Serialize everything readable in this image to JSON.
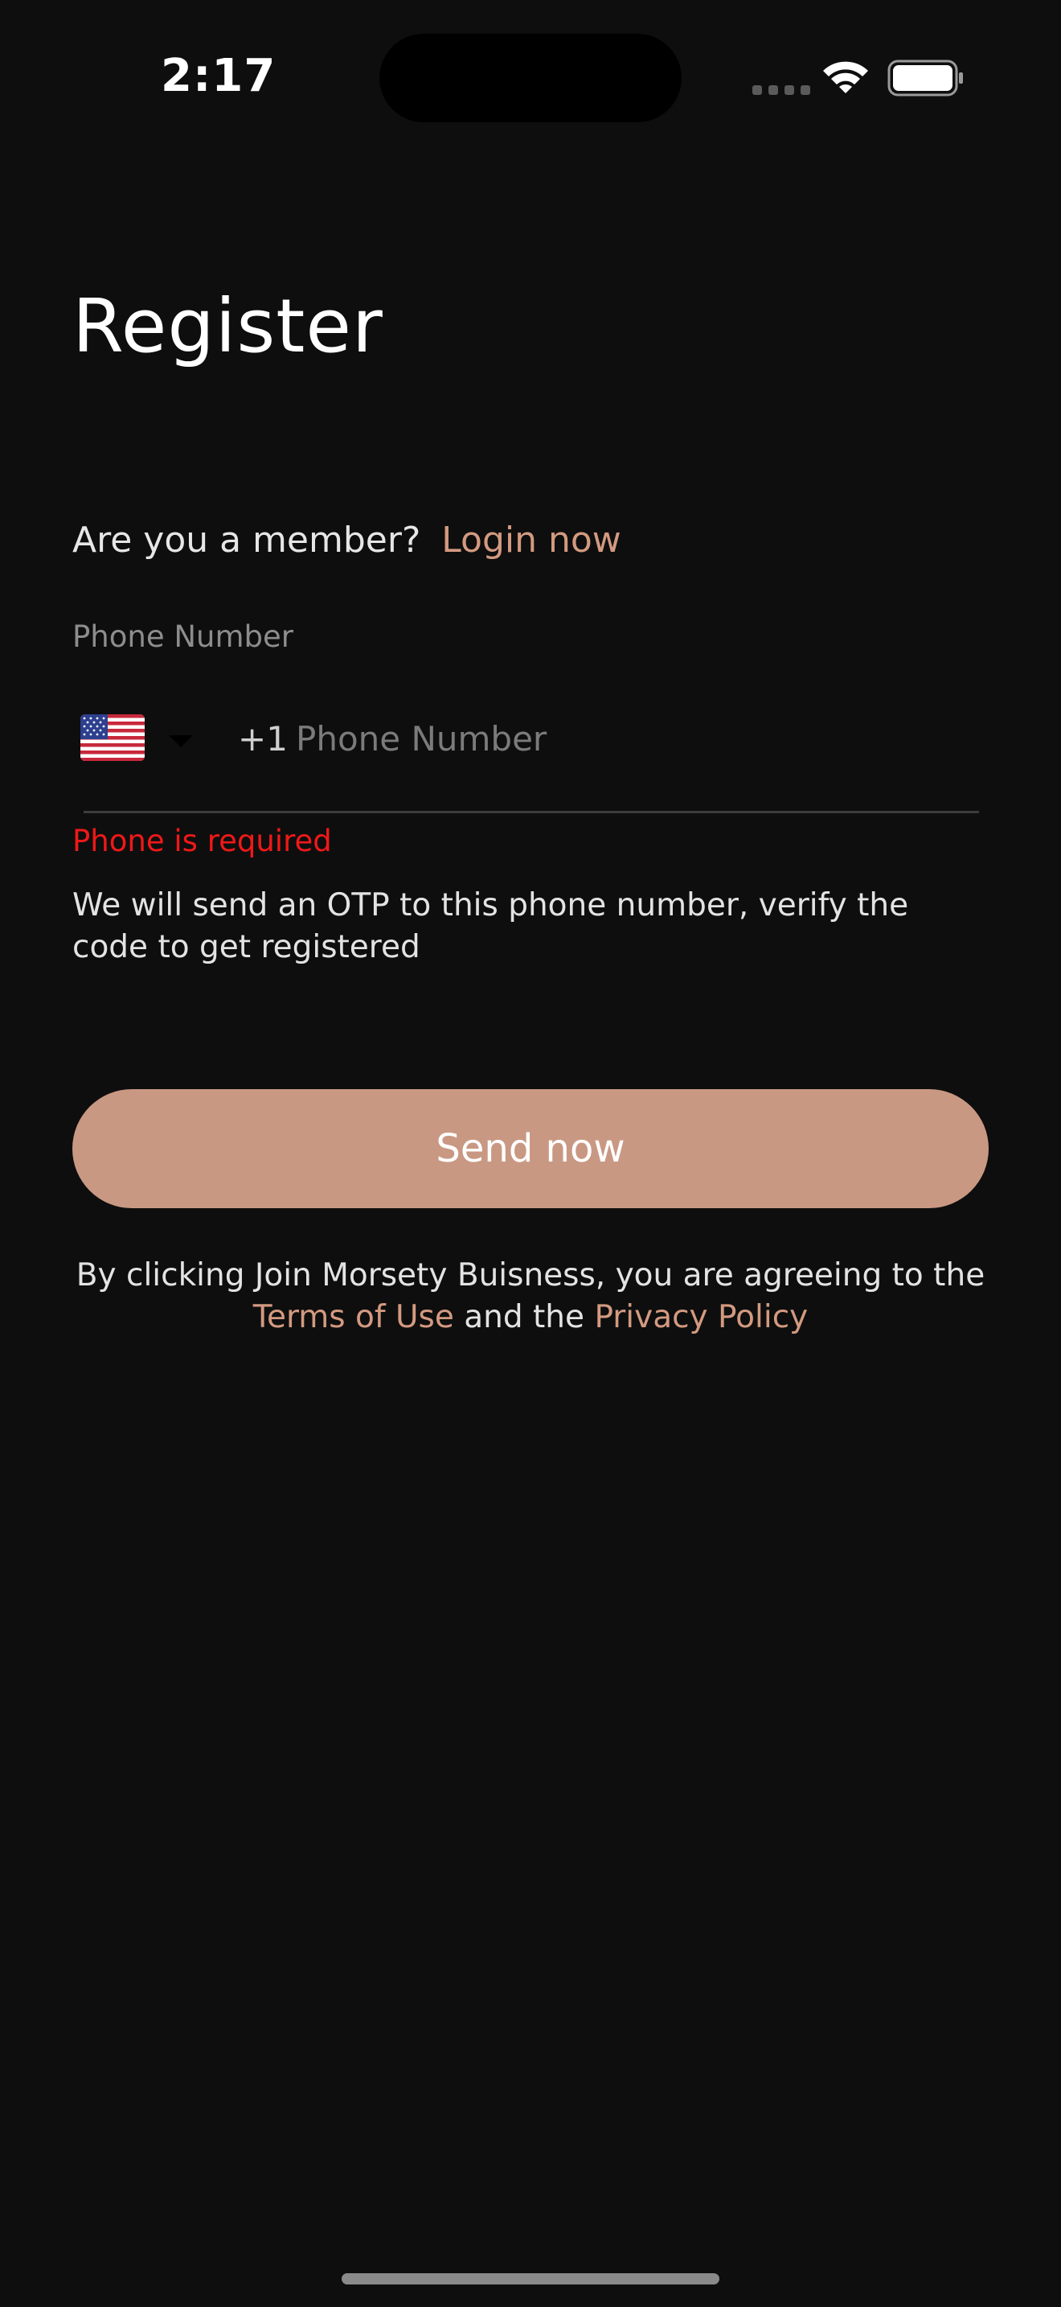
{
  "status_bar": {
    "time": "2:17"
  },
  "title": "Register",
  "member_prompt": {
    "text": "Are you a member?",
    "link": "Login now"
  },
  "phone": {
    "label": "Phone Number",
    "country_flag": "us-flag-icon",
    "dial_code": "+1",
    "placeholder": "Phone Number",
    "value": ""
  },
  "error": "Phone is required",
  "hint": "We will send an OTP to this phone number, verify the code to get registered",
  "send_button_label": "Send now",
  "legal": {
    "line1": "By clicking Join Morsety Buisness, you are agreeing to the",
    "terms_link": "Terms of Use",
    "connector": "and the",
    "privacy_link": "Privacy Policy"
  },
  "colors": {
    "background": "#0e0e0e",
    "accent": "#c99883",
    "link": "#d39a80",
    "error": "#f01818"
  }
}
